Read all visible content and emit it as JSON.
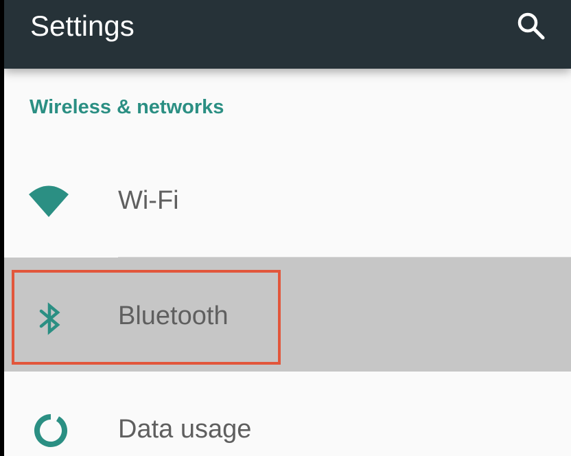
{
  "toolbar": {
    "title": "Settings",
    "search_icon": "search-icon",
    "background": "#263238"
  },
  "section": {
    "header": "Wireless & networks",
    "accent": "#2b8f83"
  },
  "items": [
    {
      "label": "Wi-Fi",
      "icon": "wifi-icon"
    },
    {
      "label": "Bluetooth",
      "icon": "bluetooth-icon",
      "pressed": true
    },
    {
      "label": "Data usage",
      "icon": "data-usage-icon"
    }
  ],
  "highlight_color": "#e2563b"
}
